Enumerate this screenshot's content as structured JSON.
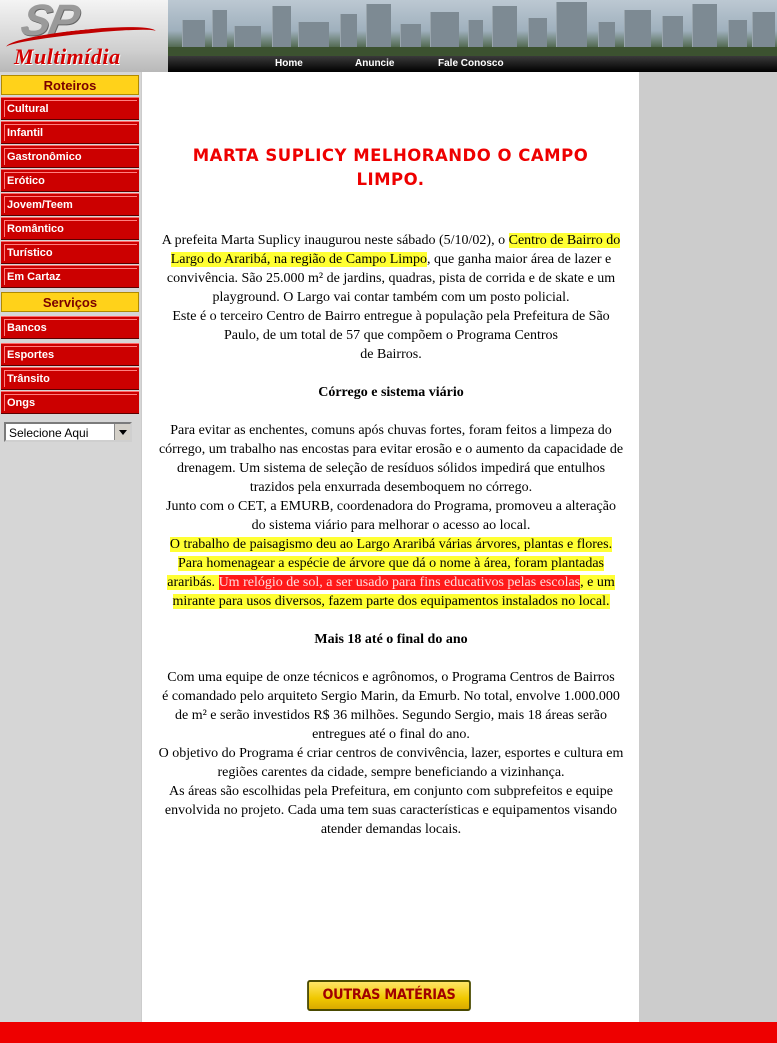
{
  "brand": {
    "logo_initials": "SP",
    "logo_name": "Multimídia"
  },
  "nav": {
    "home": "Home",
    "anuncie": "Anuncie",
    "fale_conosco": "Fale Conosco"
  },
  "sidebar": {
    "roteiros_title": "Roteiros",
    "roteiros": [
      "Cultural",
      "Infantil",
      "Gastronômico",
      "Erótico",
      "Jovem/Teem",
      "Romântico",
      "Turístico",
      "Em Cartaz"
    ],
    "servicos_title": "Serviços",
    "servicos": [
      "Bancos",
      "Esportes",
      "Trânsito",
      "Ongs"
    ],
    "select_value": "Selecione Aqui"
  },
  "article": {
    "title": "MARTA SUPLICY MELHORANDO O CAMPO LIMPO.",
    "p1_a": "A prefeita Marta Suplicy inaugurou neste sábado (5/10/02),  o ",
    "p1_hl": "Centro de Bairro do Largo do Araribá, na região de Campo Limpo",
    "p1_b": ",  que ganha maior área de lazer e convivência. São 25.000 m² de jardins, quadras, pista de corrida e de skate e um playground. O Largo vai contar também com um posto policial.",
    "p2": "Este é o terceiro Centro de Bairro entregue à população pela Prefeitura de São Paulo, de um total de 57 que compõem o Programa Centros",
    "p2b": "de Bairros.",
    "h1": "Córrego e sistema viário",
    "p3": "Para evitar as enchentes, comuns após chuvas fortes, foram feitos a limpeza do córrego, um trabalho nas encostas para evitar erosão e o aumento da capacidade de drenagem. Um sistema de seleção de resíduos sólidos impedirá que entulhos trazidos pela enxurrada desemboquem no córrego.",
    "p4": "Junto com o CET, a EMURB, coordenadora do Programa, promoveu a alteração",
    "p4b": "do sistema viário para melhorar o acesso ao local.",
    "p5_a": "O trabalho de paisagismo deu ao Largo Araribá várias árvores, plantas e flores. Para homenagear a espécie de árvore que dá o nome à área, foram plantadas araribás. ",
    "p5_red": "Um relógio de sol, a ser usado para fins educativos pelas escolas",
    "p5_b": ", e um mirante para usos diversos, fazem parte dos equipamentos instalados no local.",
    "h2": "Mais 18 até o final do ano",
    "p6": "Com uma equipe de onze técnicos e agrônomos, o Programa Centros de Bairros",
    "p6b": "é comandado pelo arquiteto Sergio Marin, da Emurb. No total, envolve 1.000.000 de m² e serão investidos R$ 36 milhões. Segundo Sergio, mais 18 áreas serão entregues até o final do ano.",
    "p7": " O objetivo do Programa é criar centros de convivência, lazer, esportes e cultura em regiões carentes da cidade, sempre beneficiando a vizinhança.",
    "p8": "As áreas são escolhidas pela Prefeitura, em conjunto com subprefeitos e equipe envolvida no projeto. Cada uma tem suas características e equipamentos visando atender demandas locais.",
    "more_button": "OUTRAS MATÉRIAS"
  },
  "colors": {
    "accent_red": "#ee0000",
    "menu_red": "#cc0000",
    "highlight_yellow": "#ffff33",
    "highlight_red": "#ff1a1a",
    "sidebar_gold": "#ffd21a"
  }
}
